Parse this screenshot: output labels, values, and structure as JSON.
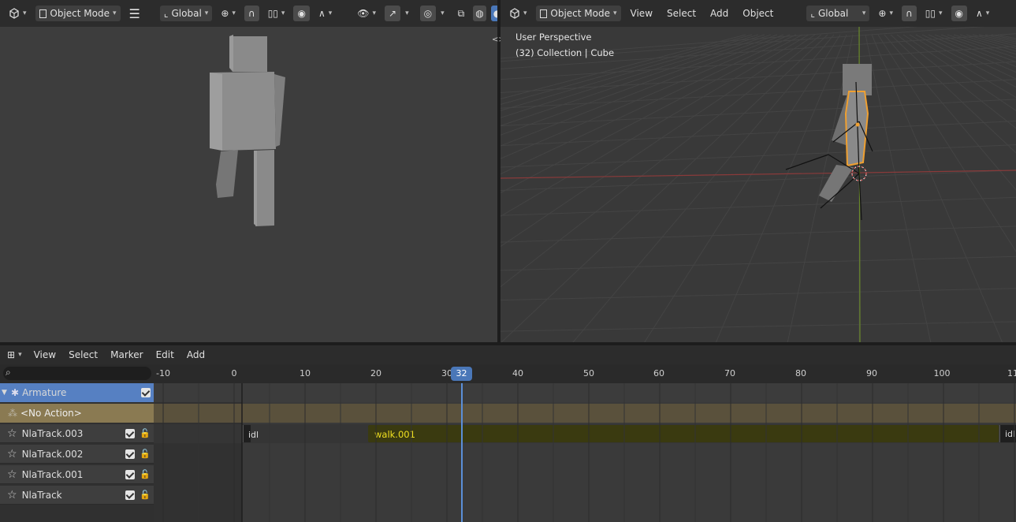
{
  "left_header": {
    "mode": "Object Mode",
    "orientation": "Global"
  },
  "right_header": {
    "mode": "Object Mode",
    "menus": [
      "View",
      "Select",
      "Add",
      "Object"
    ],
    "orientation": "Global"
  },
  "right_viewport": {
    "perspective_label": "User Perspective",
    "collection_label": "(32) Collection | Cube"
  },
  "nla": {
    "menus": [
      "View",
      "Select",
      "Marker",
      "Edit",
      "Add"
    ],
    "ruler_ticks": [
      "-10",
      "0",
      "10",
      "20",
      "30",
      "40",
      "50",
      "60",
      "70",
      "80",
      "90",
      "100",
      "11"
    ],
    "current_frame": "32",
    "channels": {
      "armature": "Armature",
      "no_action": "<No Action>",
      "tracks": [
        "NlaTrack.003",
        "NlaTrack.002",
        "NlaTrack.001",
        "NlaTrack"
      ]
    },
    "strips": {
      "idle_left": "idl",
      "walk": "walk.001",
      "idle_right": "idl"
    }
  },
  "colors": {
    "accent": "#4a77b8",
    "selection_orange": "#f0a030",
    "action_row": "#8a7a52",
    "walk_strip": "#3a3a10",
    "walk_text": "#f0e020"
  }
}
